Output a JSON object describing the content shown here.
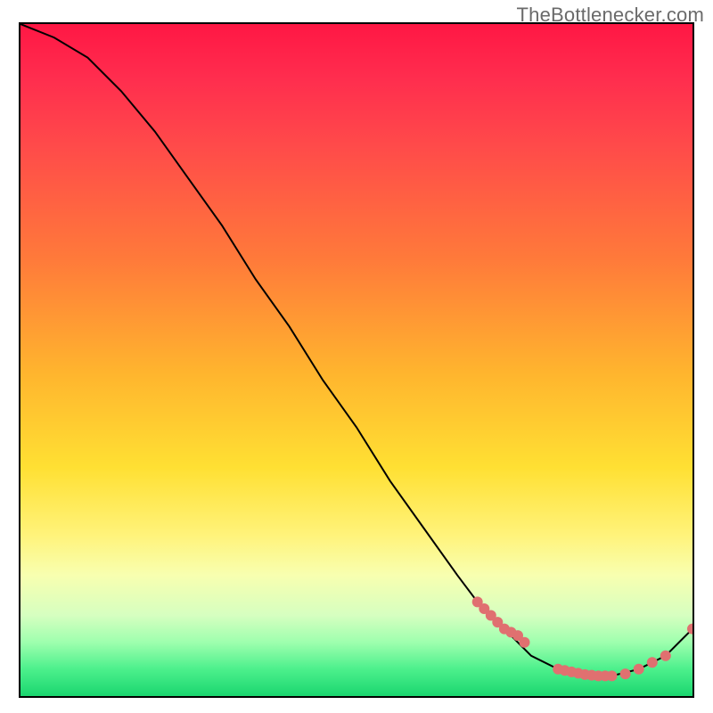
{
  "watermark": "TheBottlenecker.com",
  "chart_data": {
    "type": "line",
    "title": "",
    "xlabel": "",
    "ylabel": "",
    "xlim": [
      0,
      100
    ],
    "ylim": [
      0,
      100
    ],
    "series": [
      {
        "name": "bottleneck-curve",
        "x": [
          0,
          5,
          10,
          15,
          20,
          25,
          30,
          35,
          40,
          45,
          50,
          55,
          60,
          65,
          68,
          72,
          76,
          80,
          84,
          88,
          92,
          96,
          100
        ],
        "y": [
          100,
          98,
          95,
          90,
          84,
          77,
          70,
          62,
          55,
          47,
          40,
          32,
          25,
          18,
          14,
          10,
          6,
          4,
          3,
          3,
          4,
          6,
          10
        ]
      }
    ],
    "highlight_points": {
      "name": "dense-markers",
      "x": [
        68,
        69,
        70,
        71,
        72,
        73,
        74,
        75,
        80,
        81,
        82,
        83,
        84,
        85,
        86,
        87,
        88,
        90,
        92,
        94,
        96,
        100
      ],
      "y": [
        14,
        13,
        12,
        11,
        10,
        9.5,
        9,
        8,
        4,
        3.8,
        3.6,
        3.4,
        3.2,
        3.1,
        3.0,
        3.0,
        3.0,
        3.3,
        4,
        5,
        6,
        10
      ]
    },
    "gradient_stops": [
      {
        "pos": 0,
        "color": "#ff1744"
      },
      {
        "pos": 18,
        "color": "#ff4a4a"
      },
      {
        "pos": 35,
        "color": "#ff7a3a"
      },
      {
        "pos": 52,
        "color": "#ffb52e"
      },
      {
        "pos": 66,
        "color": "#ffe033"
      },
      {
        "pos": 82,
        "color": "#f8ffb0"
      },
      {
        "pos": 92,
        "color": "#9effae"
      },
      {
        "pos": 100,
        "color": "#1bd66f"
      }
    ],
    "marker_color": "#e07070",
    "line_color": "#000000"
  }
}
